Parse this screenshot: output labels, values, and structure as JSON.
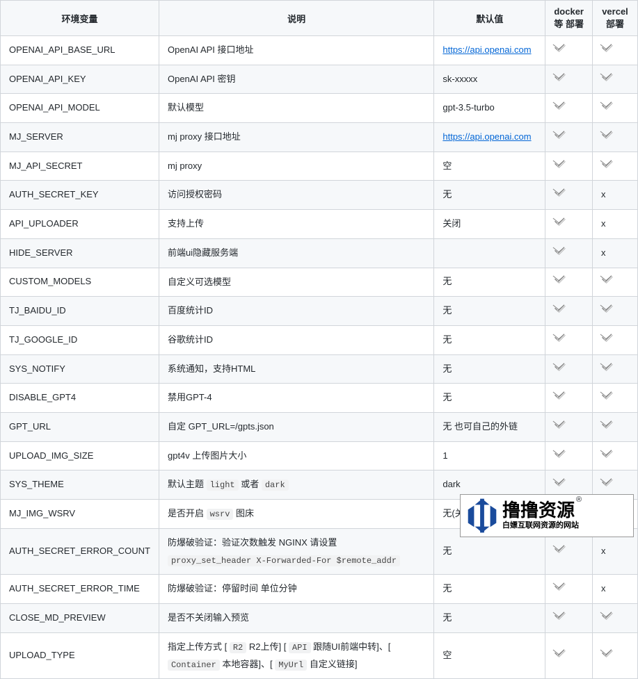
{
  "headers": [
    "环境变量",
    "说明",
    "默认值",
    "docker等 部署",
    "vercel 部署"
  ],
  "rows": [
    {
      "env": "OPENAI_API_BASE_URL",
      "desc": {
        "plain": "OpenAI API 接口地址"
      },
      "def": {
        "link": "https://api.openai.com"
      },
      "docker": "check",
      "vercel": "check"
    },
    {
      "env": "OPENAI_API_KEY",
      "desc": {
        "plain": "OpenAI API 密钥"
      },
      "def": {
        "plain": "sk-xxxxx"
      },
      "docker": "check",
      "vercel": "check"
    },
    {
      "env": "OPENAI_API_MODEL",
      "desc": {
        "plain": "默认模型"
      },
      "def": {
        "plain": "gpt-3.5-turbo"
      },
      "docker": "check",
      "vercel": "check"
    },
    {
      "env": "MJ_SERVER",
      "desc": {
        "plain": "mj proxy 接口地址"
      },
      "def": {
        "link": "https://api.openai.com"
      },
      "docker": "check",
      "vercel": "check"
    },
    {
      "env": "MJ_API_SECRET",
      "desc": {
        "plain": "mj proxy"
      },
      "def": {
        "plain": "空"
      },
      "docker": "check",
      "vercel": "check"
    },
    {
      "env": "AUTH_SECRET_KEY",
      "desc": {
        "plain": "访问授权密码"
      },
      "def": {
        "plain": "无"
      },
      "docker": "check",
      "vercel": "x"
    },
    {
      "env": "API_UPLOADER",
      "desc": {
        "plain": "支持上传"
      },
      "def": {
        "plain": "关闭"
      },
      "docker": "check",
      "vercel": "x"
    },
    {
      "env": "HIDE_SERVER",
      "desc": {
        "plain": "前端ui隐藏服务端"
      },
      "def": {
        "plain": ""
      },
      "docker": "check",
      "vercel": "x"
    },
    {
      "env": "CUSTOM_MODELS",
      "desc": {
        "plain": "自定义可选模型"
      },
      "def": {
        "plain": "无"
      },
      "docker": "check",
      "vercel": "check"
    },
    {
      "env": "TJ_BAIDU_ID",
      "desc": {
        "plain": "百度统计ID"
      },
      "def": {
        "plain": "无"
      },
      "docker": "check",
      "vercel": "check"
    },
    {
      "env": "TJ_GOOGLE_ID",
      "desc": {
        "plain": "谷歌统计ID"
      },
      "def": {
        "plain": "无"
      },
      "docker": "check",
      "vercel": "check"
    },
    {
      "env": "SYS_NOTIFY",
      "desc": {
        "plain": "系统通知，支持HTML"
      },
      "def": {
        "plain": "无"
      },
      "docker": "check",
      "vercel": "check"
    },
    {
      "env": "DISABLE_GPT4",
      "desc": {
        "plain": "禁用GPT-4"
      },
      "def": {
        "plain": "无"
      },
      "docker": "check",
      "vercel": "check"
    },
    {
      "env": "GPT_URL",
      "desc": {
        "plain": "自定 GPT_URL=/gpts.json"
      },
      "def": {
        "plain": "无 也可自己的外链"
      },
      "docker": "check",
      "vercel": "check"
    },
    {
      "env": "UPLOAD_IMG_SIZE",
      "desc": {
        "plain": "gpt4v 上传图片大小"
      },
      "def": {
        "plain": "1"
      },
      "docker": "check",
      "vercel": "check"
    },
    {
      "env": "SYS_THEME",
      "desc": {
        "parts": [
          {
            "t": "默认主题 "
          },
          {
            "c": "light"
          },
          {
            "t": " 或者 "
          },
          {
            "c": "dark"
          }
        ]
      },
      "def": {
        "plain": "dark"
      },
      "docker": "check",
      "vercel": "check"
    },
    {
      "env": "MJ_IMG_WSRV",
      "desc": {
        "parts": [
          {
            "t": "是否开启 "
          },
          {
            "c": "wsrv"
          },
          {
            "t": " 图床"
          }
        ]
      },
      "def": {
        "plain": "无(关闭)"
      },
      "docker": "check",
      "vercel": "check"
    },
    {
      "env": "AUTH_SECRET_ERROR_COUNT",
      "desc": {
        "parts": [
          {
            "t": "防爆破验证：验证次数触发 NGINX 请设置 "
          },
          {
            "br": true
          },
          {
            "c": "proxy_set_header   X-Forwarded-For  $remote_addr"
          }
        ]
      },
      "def": {
        "plain": "无"
      },
      "docker": "check",
      "vercel": "x"
    },
    {
      "env": "AUTH_SECRET_ERROR_TIME",
      "desc": {
        "plain": "防爆破验证：停留时间 单位分钟"
      },
      "def": {
        "plain": "无"
      },
      "docker": "check",
      "vercel": "x"
    },
    {
      "env": "CLOSE_MD_PREVIEW",
      "desc": {
        "plain": "是否不关闭输入预览"
      },
      "def": {
        "plain": "无"
      },
      "docker": "check",
      "vercel": "check"
    },
    {
      "env": "UPLOAD_TYPE",
      "desc": {
        "parts": [
          {
            "t": "指定上传方式 [ "
          },
          {
            "c": "R2"
          },
          {
            "t": " R2上传] [ "
          },
          {
            "c": "API"
          },
          {
            "t": " 跟随UI前端中转]、[ "
          },
          {
            "c": "Container"
          },
          {
            "t": " 本地容器]、[ "
          },
          {
            "c": "MyUrl"
          },
          {
            "t": " 自定义链接]"
          }
        ]
      },
      "def": {
        "plain": "空"
      },
      "docker": "check",
      "vercel": "check"
    }
  ],
  "logo": {
    "main": "撸撸资源",
    "reg": "®",
    "sub": "白嫖互联网资源的网站"
  }
}
